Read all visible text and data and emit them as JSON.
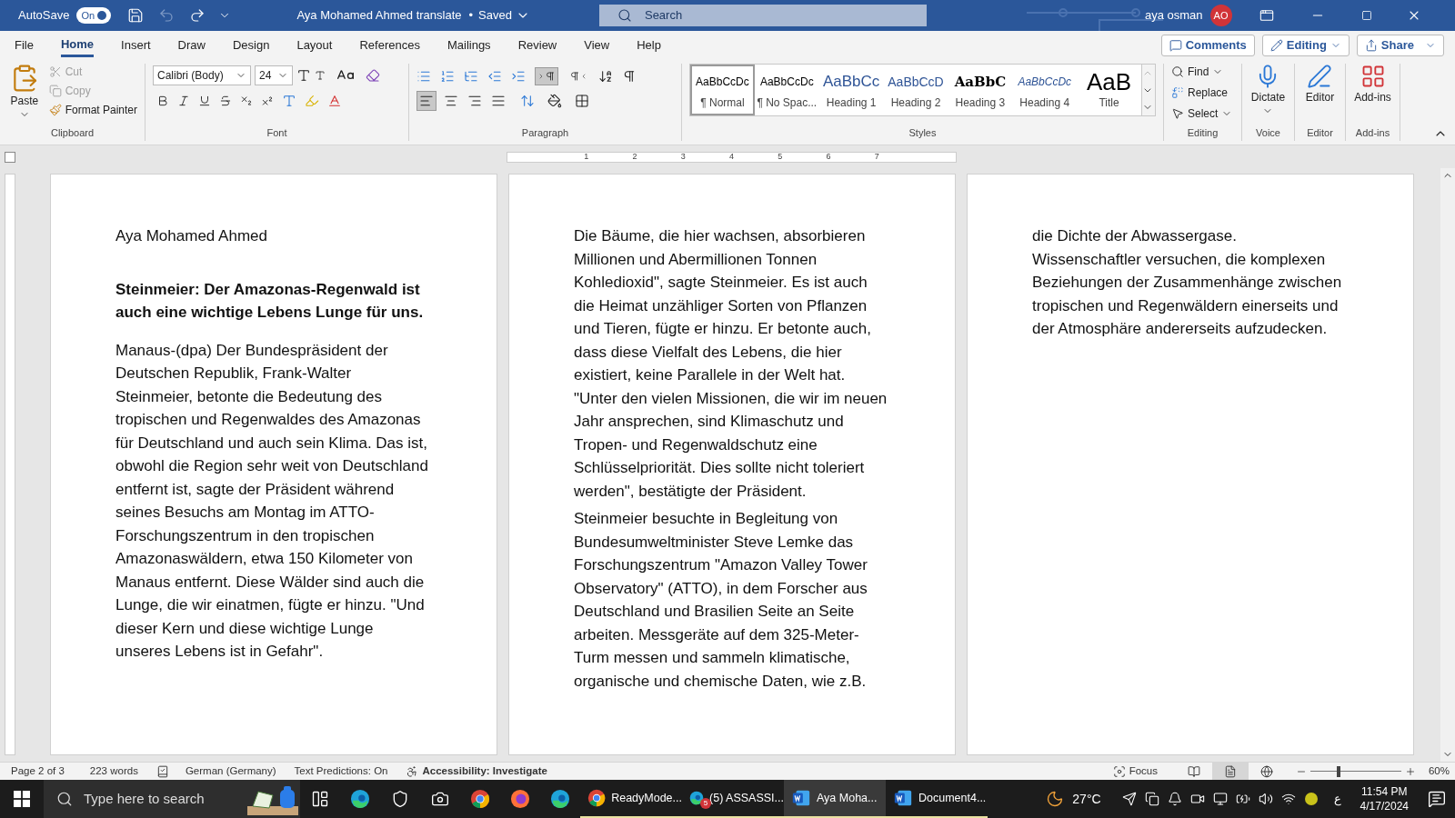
{
  "title_bar": {
    "autosave_label": "AutoSave",
    "autosave_on": true,
    "autosave_state": "On",
    "document_title": "Aya Mohamed Ahmed translate",
    "save_separator": "•",
    "save_state": "Saved",
    "search_placeholder": "Search",
    "user_name": "aya osman",
    "avatar_initials": "AO"
  },
  "menu_tabs": [
    {
      "label": "File",
      "selected": false
    },
    {
      "label": "Home",
      "selected": true
    },
    {
      "label": "Insert",
      "selected": false
    },
    {
      "label": "Draw",
      "selected": false
    },
    {
      "label": "Design",
      "selected": false
    },
    {
      "label": "Layout",
      "selected": false
    },
    {
      "label": "References",
      "selected": false
    },
    {
      "label": "Mailings",
      "selected": false
    },
    {
      "label": "Review",
      "selected": false
    },
    {
      "label": "View",
      "selected": false
    },
    {
      "label": "Help",
      "selected": false
    }
  ],
  "ribbon_actions": {
    "comments": "Comments",
    "editing": "Editing",
    "share": "Share"
  },
  "clipboard": {
    "label": "Clipboard",
    "paste": "Paste",
    "cut": "Cut",
    "cut_disabled": true,
    "copy": "Copy",
    "copy_disabled": true,
    "format_painter": "Format Painter"
  },
  "font": {
    "label": "Font",
    "font_name": "Calibri (Body)",
    "font_size": "24"
  },
  "paragraph": {
    "label": "Paragraph",
    "direction_buttons": [
      {
        "kind": "ltr",
        "selected": true
      },
      {
        "kind": "rtl",
        "selected": false
      }
    ],
    "alignment_buttons": [
      {
        "kind": "left",
        "selected": true
      },
      {
        "kind": "center",
        "selected": false
      },
      {
        "kind": "right",
        "selected": false
      },
      {
        "kind": "justify",
        "selected": false
      }
    ]
  },
  "styles": {
    "label": "Styles",
    "items": [
      {
        "preview": "AaBbCcDc",
        "name": "¶ Normal",
        "kind": "normal",
        "selected": true
      },
      {
        "preview": "AaBbCcDc",
        "name": "¶ No Spac...",
        "kind": "normal",
        "selected": false
      },
      {
        "preview": "AaBbCc",
        "name": "Heading 1",
        "kind": "heading1",
        "selected": false
      },
      {
        "preview": "AaBbCcD",
        "name": "Heading 2",
        "kind": "heading2",
        "selected": false
      },
      {
        "preview": "AaBbC",
        "name": "Heading 3",
        "kind": "heading3",
        "selected": false
      },
      {
        "preview": "AaBbCcDc",
        "name": "Heading 4",
        "kind": "heading4",
        "selected": false
      },
      {
        "preview": "AaB",
        "name": "Title",
        "kind": "title",
        "selected": false
      }
    ]
  },
  "editing": {
    "label": "Editing",
    "find": "Find",
    "replace": "Replace",
    "select": "Select"
  },
  "voice": {
    "label": "Voice",
    "dictate": "Dictate"
  },
  "editor": {
    "label": "Editor",
    "button": "Editor"
  },
  "addins": {
    "label": "Add-ins",
    "button": "Add-ins"
  },
  "ruler_marks": [
    "1",
    "2",
    "3",
    "4",
    "5",
    "6",
    "7"
  ],
  "pages": [
    {
      "paragraphs": [
        {
          "kind": "author",
          "text": "Aya Mohamed Ahmed"
        },
        {
          "kind": "heading",
          "text": "Steinmeier: Der Amazonas-Regenwald ist auch eine wichtige Lebens Lunge für uns."
        },
        {
          "kind": "body",
          "text": "Manaus-(dpa) Der Bundespräsident der Deutschen Republik, Frank-Walter Steinmeier, betonte die Bedeutung des tropischen und Regenwaldes des Amazonas für Deutschland und auch sein Klima. Das ist, obwohl die Region sehr weit von Deutschland entfernt ist, sagte der Präsident während seines Besuchs am Montag im ATTO-Forschungszentrum in den tropischen Amazonaswäldern, etwa 150 Kilometer von Manaus entfernt. Diese Wälder sind auch die Lunge, die wir einatmen, fügte er hinzu. \"Und dieser Kern und diese wichtige Lunge unseres Lebens ist in Gefahr\"."
        }
      ]
    },
    {
      "paragraphs": [
        {
          "kind": "body",
          "text": "Die Bäume, die hier wachsen, absorbieren Millionen und Abermillionen Tonnen Kohledioxid\", sagte Steinmeier. Es ist auch die Heimat unzähliger Sorten von Pflanzen und Tieren, fügte er hinzu. Er betonte auch, dass diese Vielfalt des Lebens, die hier existiert, keine Parallele in der Welt hat. \"Unter den vielen Missionen, die wir im neuen Jahr ansprechen, sind Klimaschutz und Tropen- und Regenwaldschutz eine Schlüsselpriorität. Dies sollte nicht toleriert werden\", bestätigte der Präsident."
        },
        {
          "kind": "body",
          "text": "Steinmeier besuchte in Begleitung von Bundesumweltminister Steve Lemke das Forschungszentrum \"Amazon Valley Tower Observatory\" (ATTO), in dem Forscher aus Deutschland und Brasilien Seite an Seite arbeiten. Messgeräte auf dem 325-Meter-Turm messen und sammeln klimatische, organische und chemische Daten, wie z.B."
        }
      ]
    },
    {
      "paragraphs": [
        {
          "kind": "body",
          "text": "die Dichte der Abwassergase. Wissenschaftler versuchen, die komplexen Beziehungen der Zusammenhänge zwischen tropischen und Regenwäldern einerseits und der Atmosphäre andererseits aufzudecken."
        }
      ]
    }
  ],
  "status_bar": {
    "page": "Page 2 of 3",
    "words": "223 words",
    "language": "German (Germany)",
    "text_predictions": "Text Predictions: On",
    "accessibility": "Accessibility: Investigate",
    "focus": "Focus",
    "views": [
      {
        "kind": "read",
        "selected": false
      },
      {
        "kind": "print",
        "selected": true
      },
      {
        "kind": "web",
        "selected": false
      }
    ],
    "zoom": {
      "level": 0.3,
      "reading": "60%"
    }
  },
  "taskbar": {
    "search_placeholder": "Type here to search",
    "apps": [
      {
        "kind": "chrome",
        "label": "ReadyMode...",
        "active": false
      },
      {
        "kind": "edge",
        "label": "(5) ASSASSI...",
        "active": false,
        "badge": "5"
      },
      {
        "kind": "word",
        "label": "Aya Moha...",
        "active": true
      },
      {
        "kind": "word",
        "label": "Document4...",
        "active": false
      }
    ],
    "temperature": "27°C",
    "input_language": "ع",
    "time": "11:54 PM",
    "date": "4/17/2024"
  }
}
